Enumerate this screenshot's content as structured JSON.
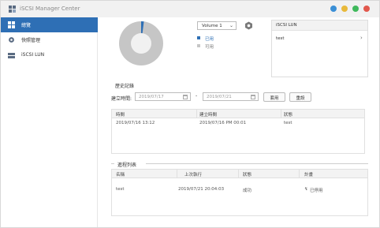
{
  "window": {
    "title": "iSCSI Manager Center",
    "buttons": [
      {
        "name": "info-button",
        "color": "#3a8fd6"
      },
      {
        "name": "minimize-button",
        "color": "#e8b93a"
      },
      {
        "name": "maximize-button",
        "color": "#3fb95c"
      },
      {
        "name": "close-button",
        "color": "#e1574c"
      }
    ]
  },
  "sidebar": {
    "items": [
      {
        "label": "總覽",
        "icon": "grid-icon",
        "active": true
      },
      {
        "label": "快照管理",
        "icon": "gear-icon",
        "active": false
      },
      {
        "label": "iSCSI LUN",
        "icon": "server-icon",
        "active": false
      }
    ]
  },
  "overview": {
    "volume_select": "Volume 1",
    "legend": [
      {
        "label": "已用",
        "color": "#2e6fb5"
      },
      {
        "label": "可用",
        "color": "#c6c6c6"
      }
    ],
    "used_fraction": 0.02,
    "lun_panel": {
      "title": "iSCSI LUN",
      "item": "test"
    }
  },
  "history": {
    "title": "歷史記錄",
    "filter_label": "建立時間:",
    "date_from": "2019/07/17",
    "date_to": "2019/07/21",
    "dash": "-",
    "apply_label": "套用",
    "reset_label": "重設",
    "columns": [
      "時間",
      "建立時間",
      "狀態"
    ],
    "rows": [
      [
        "2019/07/16 13:12",
        "2019/07/16 PM 00:01",
        "test"
      ]
    ]
  },
  "tasks": {
    "title": "進程列表",
    "columns": [
      "名稱",
      "上次執行",
      "狀態",
      "計畫"
    ],
    "rows": [
      [
        "test",
        "2019/07/21 20:04:03",
        "成功",
        "已停用"
      ]
    ]
  }
}
